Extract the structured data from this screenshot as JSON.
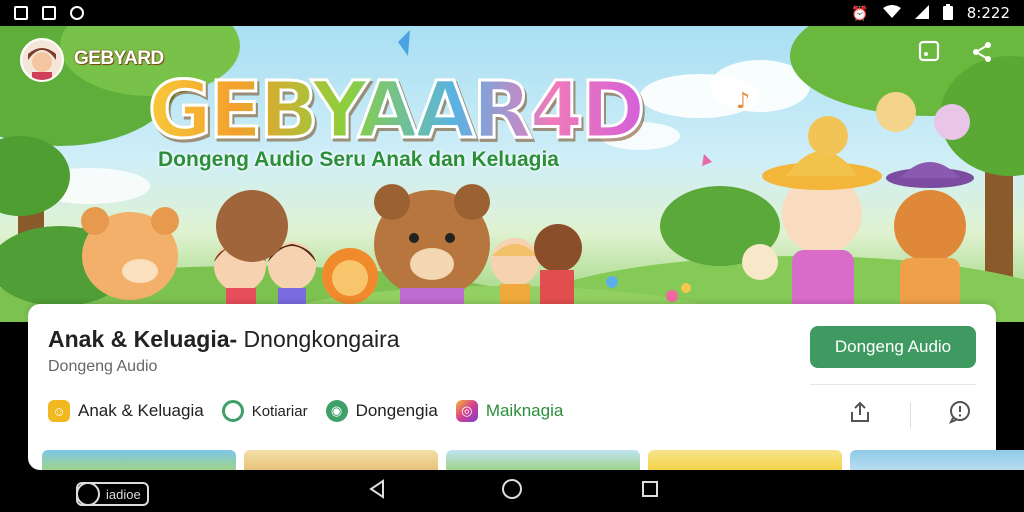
{
  "status_bar": {
    "time": "8:222"
  },
  "banner": {
    "channel_name": "GEBYARD",
    "title": "GEBYAAR4D",
    "tagline": "Dongeng Audio Seru Anak dan Keluagia",
    "icons": {
      "cast": "cast-icon",
      "share": "share-icon"
    }
  },
  "card": {
    "title_bold": "Anak & Keluagia-",
    "title_rest": " Dnongkongaira",
    "subtitle": "Dongeng Audio",
    "cta_label": "Dongeng Audio",
    "chips": [
      {
        "label": "Anak & Keluagia",
        "color": "#f2b81f",
        "icon": "smiley-icon"
      },
      {
        "label": "Kotiariar",
        "color": "#3fa06a",
        "icon": "clock-icon"
      },
      {
        "label": "Dongengia",
        "color": "#3fa06a",
        "icon": "disc-icon"
      },
      {
        "label": "Maiknagia",
        "color": "#d43f8d",
        "icon": "instagram-icon"
      }
    ],
    "chip_last_color": "#2b8f3a",
    "actions": {
      "share": "share-up-icon",
      "feedback": "feedback-icon"
    }
  },
  "thumbnails": [
    {
      "color": "#7dc6e8"
    },
    {
      "color": "#e8c27a"
    },
    {
      "color": "#9fd48a"
    },
    {
      "color": "#f3d34a"
    },
    {
      "color": "#b7dcf0"
    }
  ],
  "nav_bar": {
    "left_label": "iadioe"
  },
  "colors": {
    "accent": "#3f9a62",
    "status_bar": "#000000"
  }
}
